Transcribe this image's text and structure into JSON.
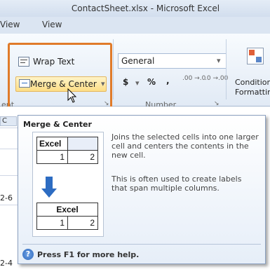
{
  "window": {
    "title": "ContactSheet.xlsx - Microsoft Excel"
  },
  "tabs": [
    "View",
    "View"
  ],
  "ribbon": {
    "wrap_text": "Wrap Text",
    "merge_center": "Merge & Center",
    "number_format": "General",
    "currency": "$",
    "percent": "%",
    "comma": ",",
    "inc_decimal": ".00 →.0",
    "dec_decimal": ".0 →.00",
    "conditional_1": "Condition",
    "conditional_2": "Formattin",
    "group_alignment": "ent",
    "group_number": "Number"
  },
  "sheet": {
    "col_partial": "C",
    "row_partial_1": "2-6",
    "row_partial_2": "2-4"
  },
  "tooltip": {
    "title": "Merge & Center",
    "desc1": "Joins the selected cells into one larger cell and centers the contents in the new cell.",
    "desc2": "This is often used to create labels that span multiple columns.",
    "footer": "Press F1 for more help.",
    "before": {
      "label": "Excel",
      "v1": "1",
      "v2": "2"
    },
    "after": {
      "label": "Excel",
      "v1": "1",
      "v2": "2"
    }
  }
}
